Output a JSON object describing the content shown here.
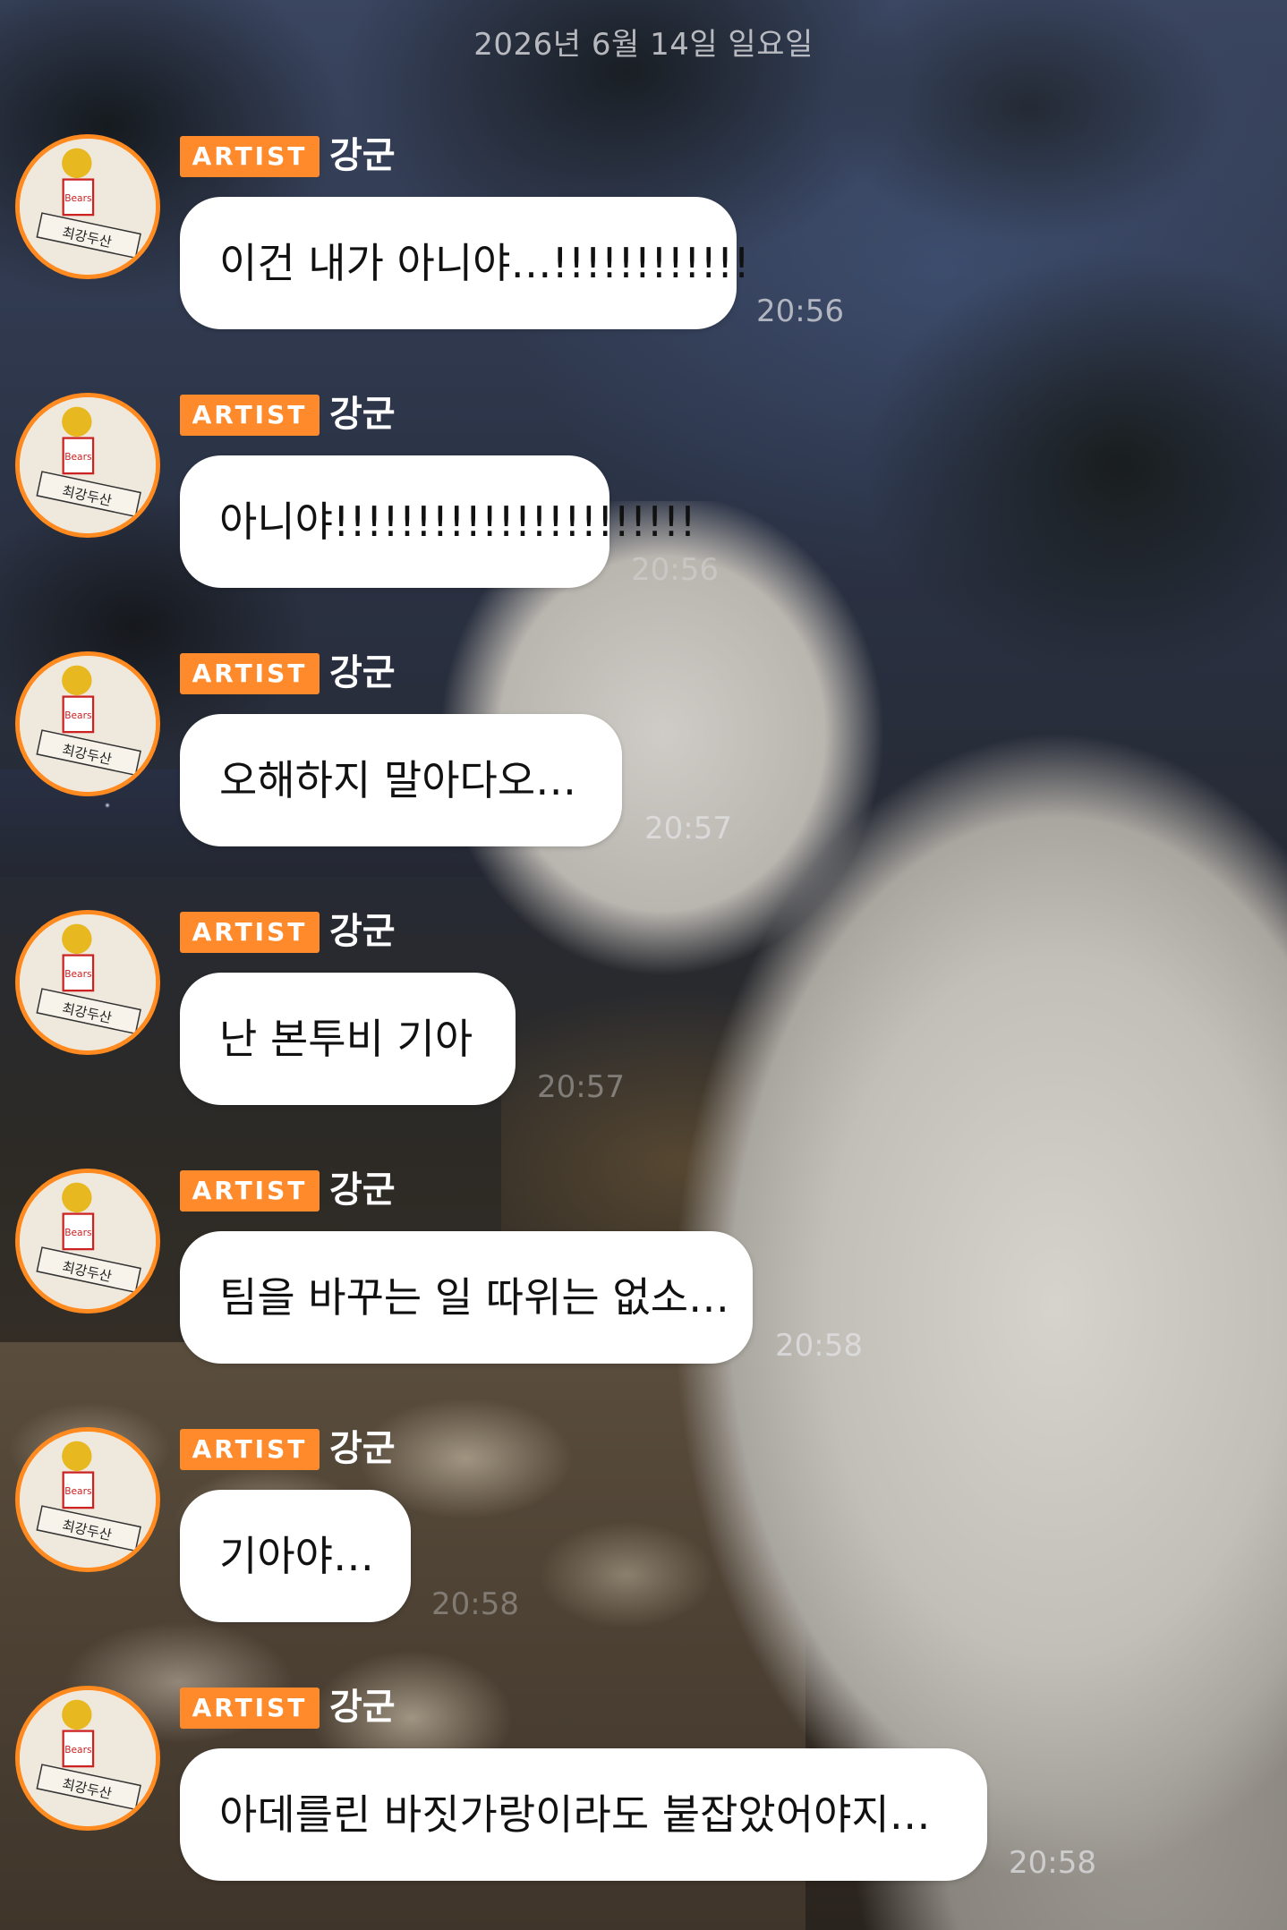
{
  "date_divider": "2026년 6월 14일 일요일",
  "messages": [
    {
      "badge": "ARTIST",
      "name": "강군",
      "text": "이건 내가 아니야…!!!!!!!!!!!!",
      "time": "20:56"
    },
    {
      "badge": "ARTIST",
      "name": "강군",
      "text": "아니야!!!!!!!!!!!!!!!!!!!!!!",
      "time": "20:56"
    },
    {
      "badge": "ARTIST",
      "name": "강군",
      "text": "오해하지 말아다오…",
      "time": "20:57"
    },
    {
      "badge": "ARTIST",
      "name": "강군",
      "text": "난 본투비 기아",
      "time": "20:57"
    },
    {
      "badge": "ARTIST",
      "name": "강군",
      "text": "팀을 바꾸는 일 따위는 없소…",
      "time": "20:58"
    },
    {
      "badge": "ARTIST",
      "name": "강군",
      "text": "기아야…",
      "time": "20:58"
    },
    {
      "badge": "ARTIST",
      "name": "강군",
      "text": "아데를린 바짓가랑이라도 붙잡았어야지…",
      "time": "20:58"
    }
  ],
  "avatar_sign_text": "최강두산",
  "colors": {
    "accent": "#ff8a2c",
    "bubble": "#ffffff"
  }
}
